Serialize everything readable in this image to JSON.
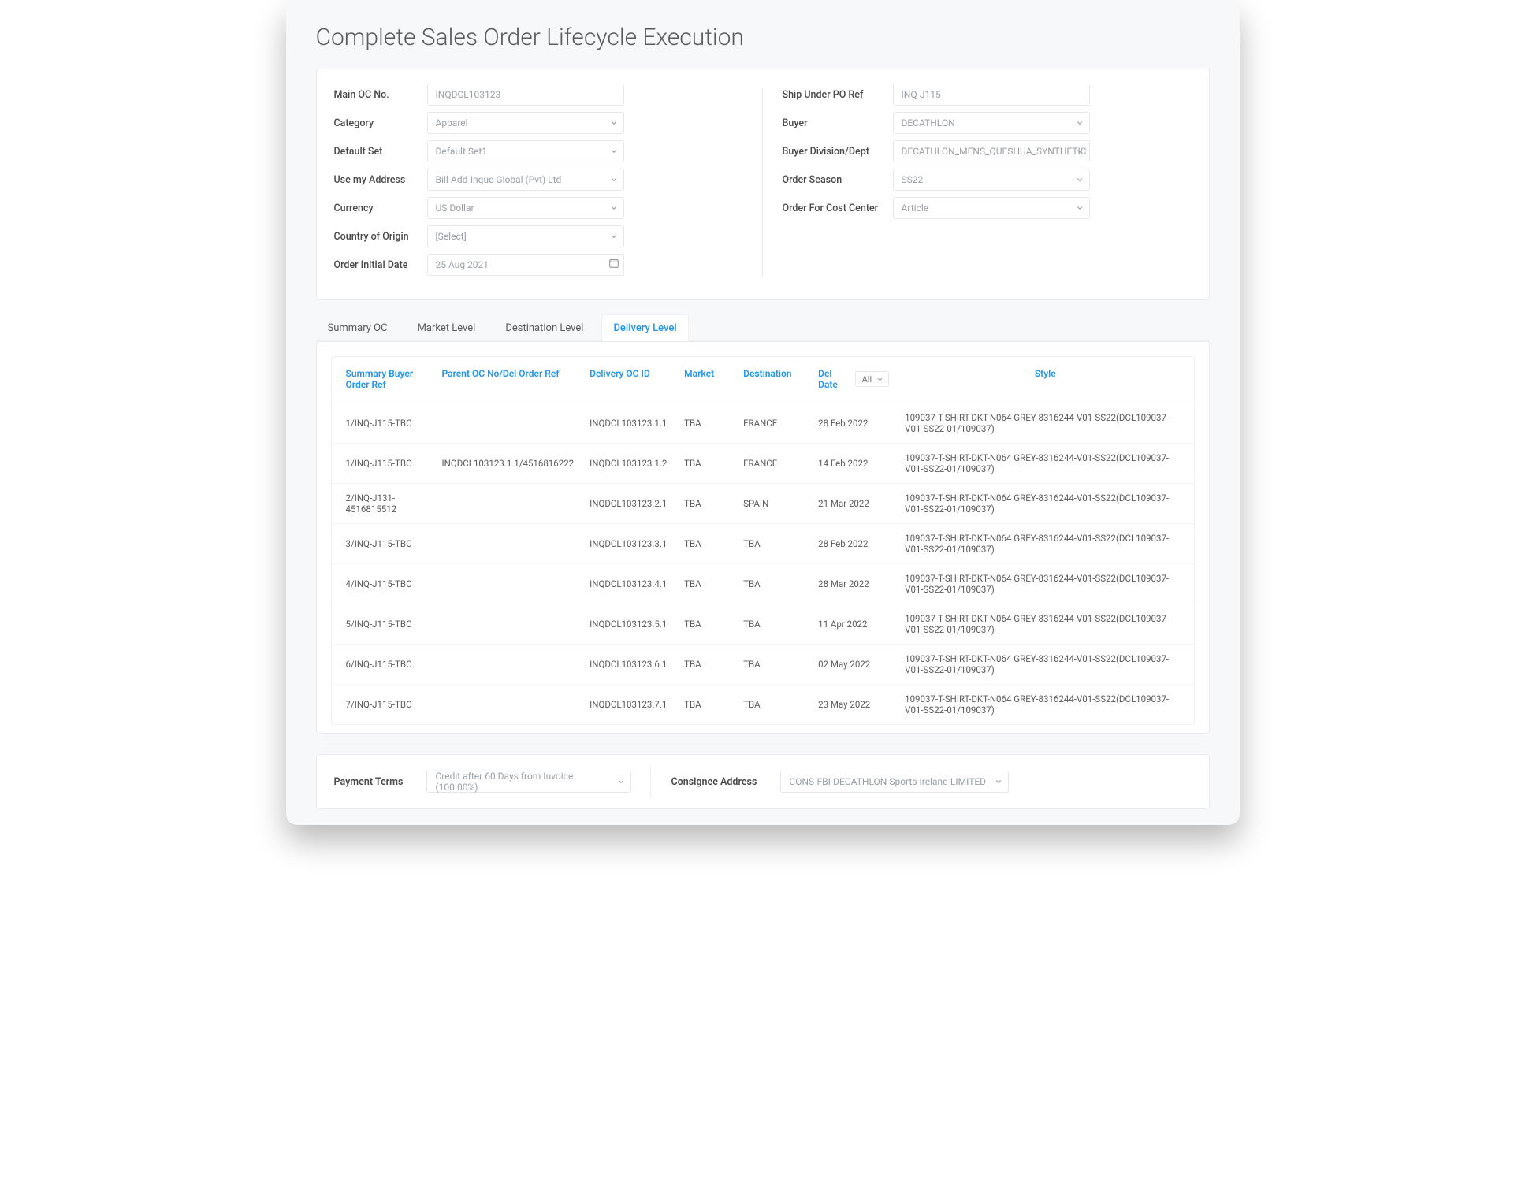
{
  "title": "Complete Sales Order Lifecycle Execution",
  "form": {
    "left": {
      "main_oc_no": {
        "label": "Main OC No.",
        "value": "INQDCL103123"
      },
      "category": {
        "label": "Category",
        "value": "Apparel"
      },
      "default_set": {
        "label": "Default Set",
        "value": "Default Set1"
      },
      "use_my_address": {
        "label": "Use my Address",
        "value": "Bill-Add-Inque Global (Pvt) Ltd"
      },
      "currency": {
        "label": "Currency",
        "value": "US Dollar"
      },
      "country_of_origin": {
        "label": "Country of Origin",
        "value": "[Select]"
      },
      "order_initial_date": {
        "label": "Order Initial Date",
        "value": "25 Aug 2021"
      }
    },
    "right": {
      "ship_under_po_ref": {
        "label": "Ship Under PO Ref",
        "value": "INQ-J115"
      },
      "buyer": {
        "label": "Buyer",
        "value": "DECATHLON"
      },
      "buyer_division": {
        "label": "Buyer Division/Dept",
        "value": "DECATHLON_MENS_QUESHUA_SYNTHETIC"
      },
      "order_season": {
        "label": "Order Season",
        "value": "SS22"
      },
      "order_for_cost_center": {
        "label": "Order For Cost Center",
        "value": "Article"
      }
    }
  },
  "tabs": [
    {
      "label": "Summary OC",
      "active": false
    },
    {
      "label": "Market Level",
      "active": false
    },
    {
      "label": "Destination Level",
      "active": false
    },
    {
      "label": "Delivery Level",
      "active": true
    }
  ],
  "table": {
    "headers": {
      "summary_ref": "Summary Buyer Order Ref",
      "parent_oc": "Parent OC No/Del Order Ref",
      "delivery_oc": "Delivery OC ID",
      "market": "Market",
      "destination": "Destination",
      "del_date": "Del Date",
      "del_date_filter": "All",
      "style": "Style"
    },
    "rows": [
      {
        "summary_ref": "1/INQ-J115-TBC",
        "parent_oc": "",
        "delivery_oc": "INQDCL103123.1.1",
        "market": "TBA",
        "destination": "FRANCE",
        "del_date": "28 Feb 2022",
        "style": "109037-T-SHIRT-DKT-N064 GREY-8316244-V01-SS22(DCL109037-V01-SS22-01/109037)"
      },
      {
        "summary_ref": "1/INQ-J115-TBC",
        "parent_oc": "INQDCL103123.1.1/4516816222",
        "delivery_oc": "INQDCL103123.1.2",
        "market": "TBA",
        "destination": "FRANCE",
        "del_date": "14 Feb 2022",
        "style": "109037-T-SHIRT-DKT-N064 GREY-8316244-V01-SS22(DCL109037-V01-SS22-01/109037)"
      },
      {
        "summary_ref": "2/INQ-J131-4516815512",
        "parent_oc": "",
        "delivery_oc": "INQDCL103123.2.1",
        "market": "TBA",
        "destination": "SPAIN",
        "del_date": "21 Mar 2022",
        "style": "109037-T-SHIRT-DKT-N064 GREY-8316244-V01-SS22(DCL109037-V01-SS22-01/109037)"
      },
      {
        "summary_ref": "3/INQ-J115-TBC",
        "parent_oc": "",
        "delivery_oc": "INQDCL103123.3.1",
        "market": "TBA",
        "destination": "TBA",
        "del_date": "28 Feb 2022",
        "style": "109037-T-SHIRT-DKT-N064 GREY-8316244-V01-SS22(DCL109037-V01-SS22-01/109037)"
      },
      {
        "summary_ref": "4/INQ-J115-TBC",
        "parent_oc": "",
        "delivery_oc": "INQDCL103123.4.1",
        "market": "TBA",
        "destination": "TBA",
        "del_date": "28 Mar 2022",
        "style": "109037-T-SHIRT-DKT-N064 GREY-8316244-V01-SS22(DCL109037-V01-SS22-01/109037)"
      },
      {
        "summary_ref": "5/INQ-J115-TBC",
        "parent_oc": "",
        "delivery_oc": "INQDCL103123.5.1",
        "market": "TBA",
        "destination": "TBA",
        "del_date": "11 Apr 2022",
        "style": "109037-T-SHIRT-DKT-N064 GREY-8316244-V01-SS22(DCL109037-V01-SS22-01/109037)"
      },
      {
        "summary_ref": "6/INQ-J115-TBC",
        "parent_oc": "",
        "delivery_oc": "INQDCL103123.6.1",
        "market": "TBA",
        "destination": "TBA",
        "del_date": "02 May 2022",
        "style": "109037-T-SHIRT-DKT-N064 GREY-8316244-V01-SS22(DCL109037-V01-SS22-01/109037)"
      },
      {
        "summary_ref": "7/INQ-J115-TBC",
        "parent_oc": "",
        "delivery_oc": "INQDCL103123.7.1",
        "market": "TBA",
        "destination": "TBA",
        "del_date": "23 May 2022",
        "style": "109037-T-SHIRT-DKT-N064 GREY-8316244-V01-SS22(DCL109037-V01-SS22-01/109037)"
      }
    ]
  },
  "bottom": {
    "payment_terms": {
      "label": "Payment Terms",
      "value": "Credit after 60 Days from Invoice (100.00%)"
    },
    "consignee_address": {
      "label": "Consignee Address",
      "value": "CONS-FBI-DECATHLON Sports Ireland LIMITED"
    }
  }
}
